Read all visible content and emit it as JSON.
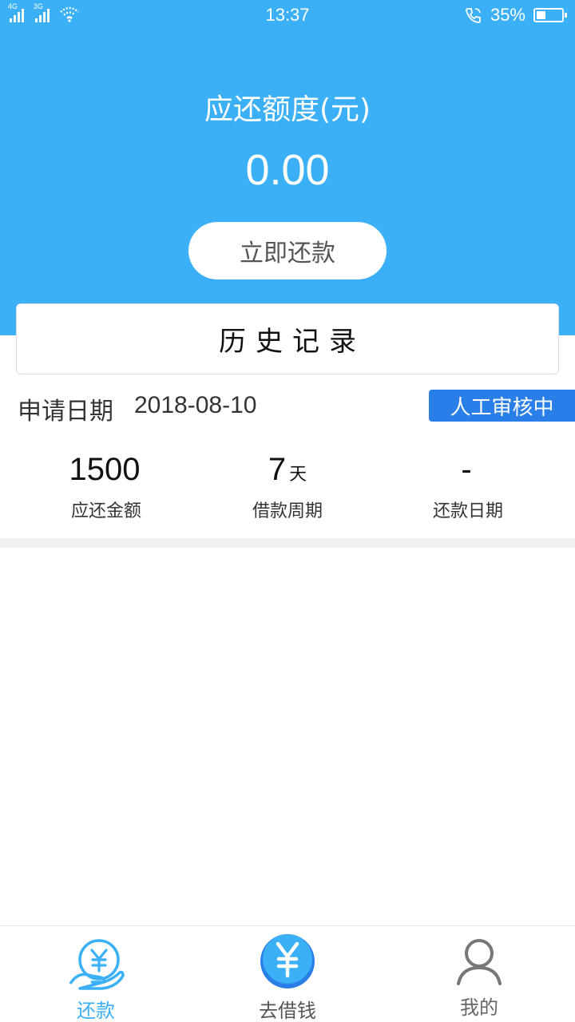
{
  "status_bar": {
    "signal_1_tag": "4G",
    "signal_2_tag": "3G",
    "time": "13:37",
    "battery_percent_text": "35%",
    "battery_level": 0.35
  },
  "summary": {
    "title": "应还额度(元)",
    "amount": "0.00",
    "repay_button": "立即还款"
  },
  "history_button": "历史记录",
  "application": {
    "date_label": "申请日期",
    "date_value": "2018-08-10",
    "status_badge": "人工审核中"
  },
  "stats": [
    {
      "value": "1500",
      "unit": "",
      "label": "应还金额"
    },
    {
      "value": "7",
      "unit": "天",
      "label": "借款周期"
    },
    {
      "value": "-",
      "unit": "",
      "label": "还款日期"
    }
  ],
  "tabs": [
    {
      "label": "还款",
      "icon": "yen-hand-icon",
      "active": true
    },
    {
      "label": "去借钱",
      "icon": "yen-coin-icon",
      "active": false
    },
    {
      "label": "我的",
      "icon": "user-icon",
      "active": false
    }
  ],
  "colors": {
    "brand_blue": "#3bb0f7",
    "badge_blue": "#2a7ee8",
    "band_gray": "#f3efee"
  }
}
